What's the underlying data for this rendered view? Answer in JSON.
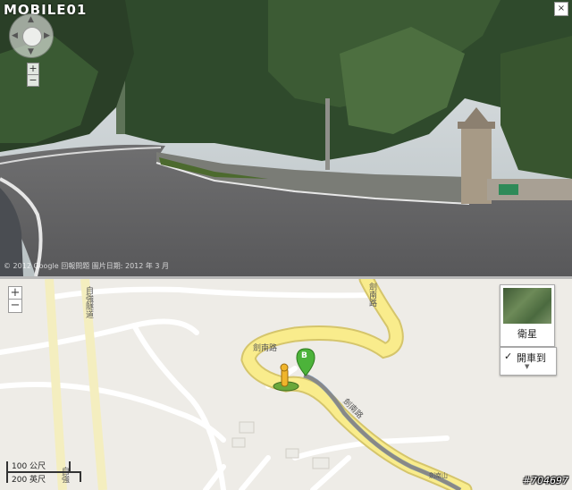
{
  "brand": {
    "logo": "MOBILE01"
  },
  "street_view": {
    "copyright": "© 2012 Google  回報問題  圖片日期: 2012 年 3 月",
    "zoom_in": "+",
    "zoom_out": "−",
    "close": "×"
  },
  "map": {
    "zoom_in": "+",
    "zoom_out": "−",
    "satellite_label": "衛星",
    "drive_check": "✓",
    "drive_label": "開車到 ",
    "road_name_1": "劍南路",
    "road_name_2": "劍南路",
    "road_name_3": "自強隧道",
    "road_name_4": "劍南路",
    "road_name_5": "劍南山",
    "road_name_6": "自強",
    "marker_label": "B",
    "scale_metric": "100 公尺",
    "scale_imperial": "200 英尺"
  },
  "watermark": "#704697"
}
